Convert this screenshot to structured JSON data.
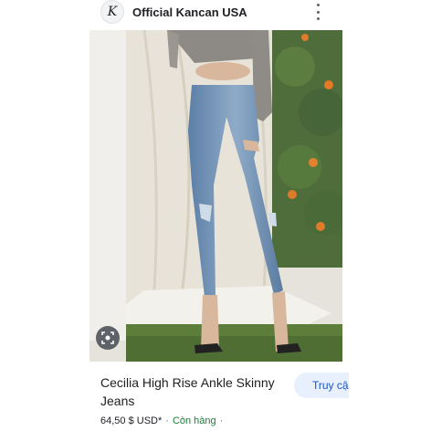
{
  "seller": {
    "name": "Official Kancan USA",
    "logo_letter": "K"
  },
  "product": {
    "title_line1": "Cecilia High Rise Ankle Skinny",
    "title_line2": "Jeans",
    "price": "64,50 $ USD*",
    "availability": "Còn hàng",
    "separator": "·"
  },
  "actions": {
    "cta_label": "Truy cập"
  },
  "icons": {
    "more": "more-vert-icon",
    "lens": "lens-icon"
  },
  "colors": {
    "cta_bg": "#e8f0fe",
    "cta_text": "#1a56c8",
    "stock": "#188038"
  }
}
